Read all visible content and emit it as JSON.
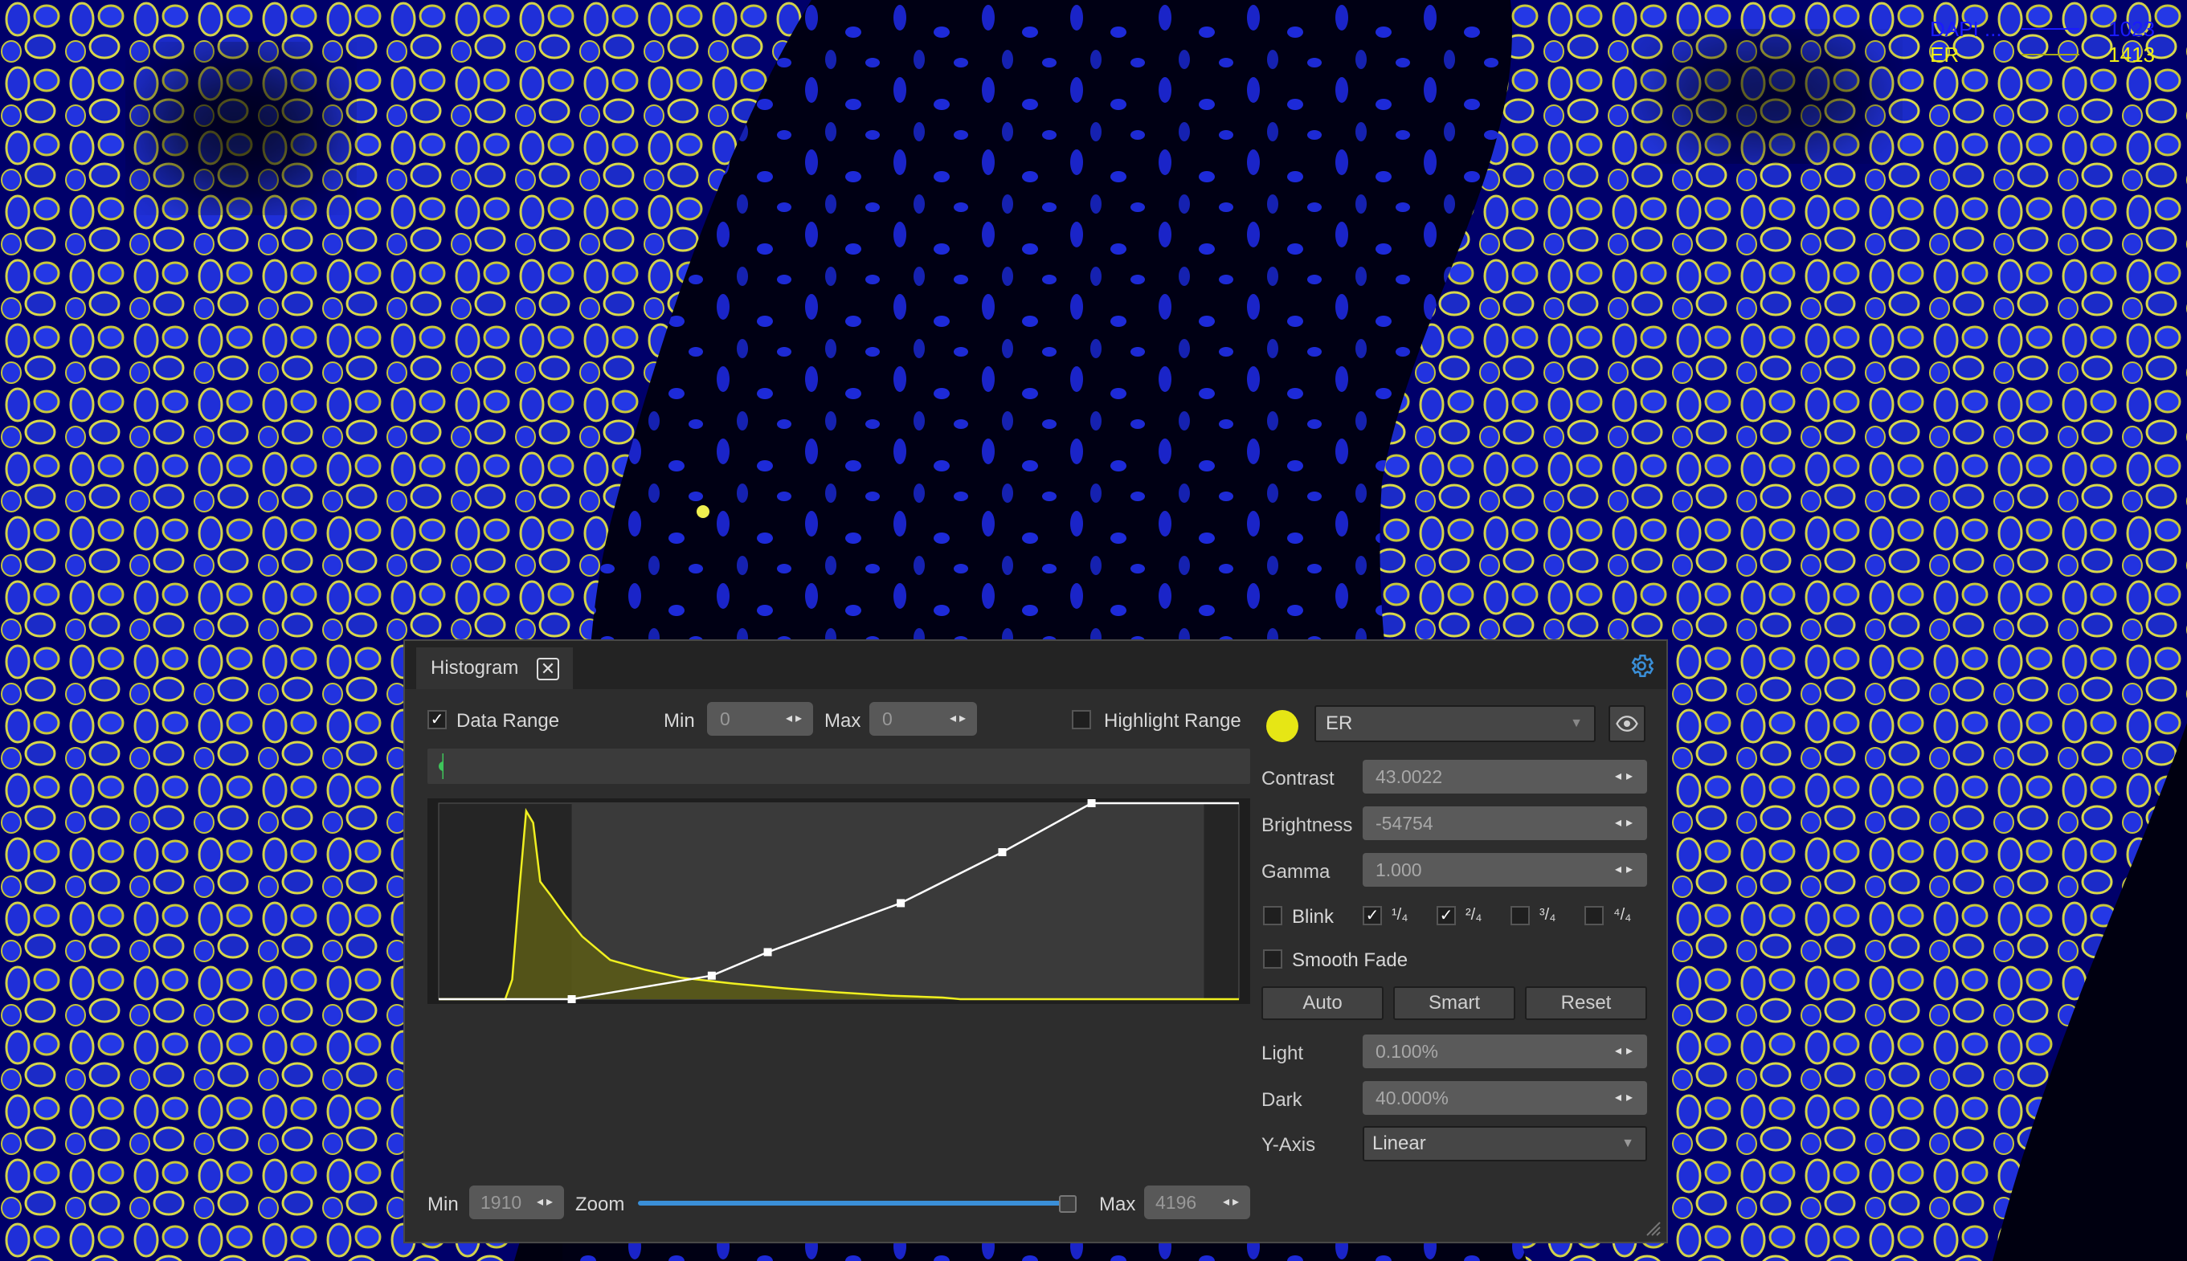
{
  "overlay": {
    "channels": [
      {
        "name": "DAPI ...",
        "value": "1023",
        "color": "#1a1aff"
      },
      {
        "name": "ER",
        "value": "1413",
        "color": "#f0f016"
      }
    ]
  },
  "panel": {
    "tab_title": "Histogram",
    "data_range_label": "Data Range",
    "data_range_checked": true,
    "min_label": "Min",
    "min_value": "0",
    "max_label": "Max",
    "max_value": "0",
    "highlight_range_label": "Highlight Range",
    "highlight_range_checked": false,
    "channel_color": "#e6e615",
    "channel_select": "ER",
    "contrast_label": "Contrast",
    "contrast_value": "43.0022",
    "brightness_label": "Brightness",
    "brightness_value": "-54754",
    "gamma_label": "Gamma",
    "gamma_value": "1.000",
    "blink_label": "Blink",
    "blink_checked": false,
    "quarters": [
      {
        "label": "¹/₄",
        "checked": true
      },
      {
        "label": "²/₄",
        "checked": true
      },
      {
        "label": "³/₄",
        "checked": false
      },
      {
        "label": "⁴/₄",
        "checked": false
      }
    ],
    "smooth_fade_label": "Smooth Fade",
    "smooth_fade_checked": false,
    "auto_label": "Auto",
    "smart_label": "Smart",
    "reset_label": "Reset",
    "light_label": "Light",
    "light_value": "0.100%",
    "dark_label": "Dark",
    "dark_value": "40.000%",
    "yaxis_label": "Y-Axis",
    "yaxis_value": "Linear",
    "bottom_min_label": "Min",
    "bottom_min_value": "1910",
    "zoom_label": "Zoom",
    "zoom_level": 1.0,
    "bottom_max_label": "Max",
    "bottom_max_value": "4196",
    "accent_color": "#3a8fd8"
  },
  "chart_data": {
    "type": "area",
    "x_range": [
      1910,
      4196
    ],
    "y_scale": "Linear",
    "window": [
      2290,
      4096
    ],
    "histogram": {
      "x": [
        1910,
        2100,
        2120,
        2140,
        2160,
        2180,
        2200,
        2230,
        2270,
        2320,
        2400,
        2500,
        2600,
        2750,
        2900,
        3050,
        3200,
        3350,
        3400,
        3600,
        3800,
        4196
      ],
      "y": [
        0,
        0,
        0.1,
        0.55,
        0.96,
        0.9,
        0.6,
        0.53,
        0.43,
        0.32,
        0.2,
        0.15,
        0.11,
        0.08,
        0.055,
        0.035,
        0.018,
        0.008,
        0,
        0,
        0,
        0
      ]
    },
    "transfer_curve": {
      "x": [
        1910,
        2290,
        2690,
        2850,
        3230,
        3520,
        3775,
        4196
      ],
      "y": [
        0,
        0,
        0.12,
        0.24,
        0.49,
        0.75,
        1.0,
        1.0
      ]
    }
  }
}
